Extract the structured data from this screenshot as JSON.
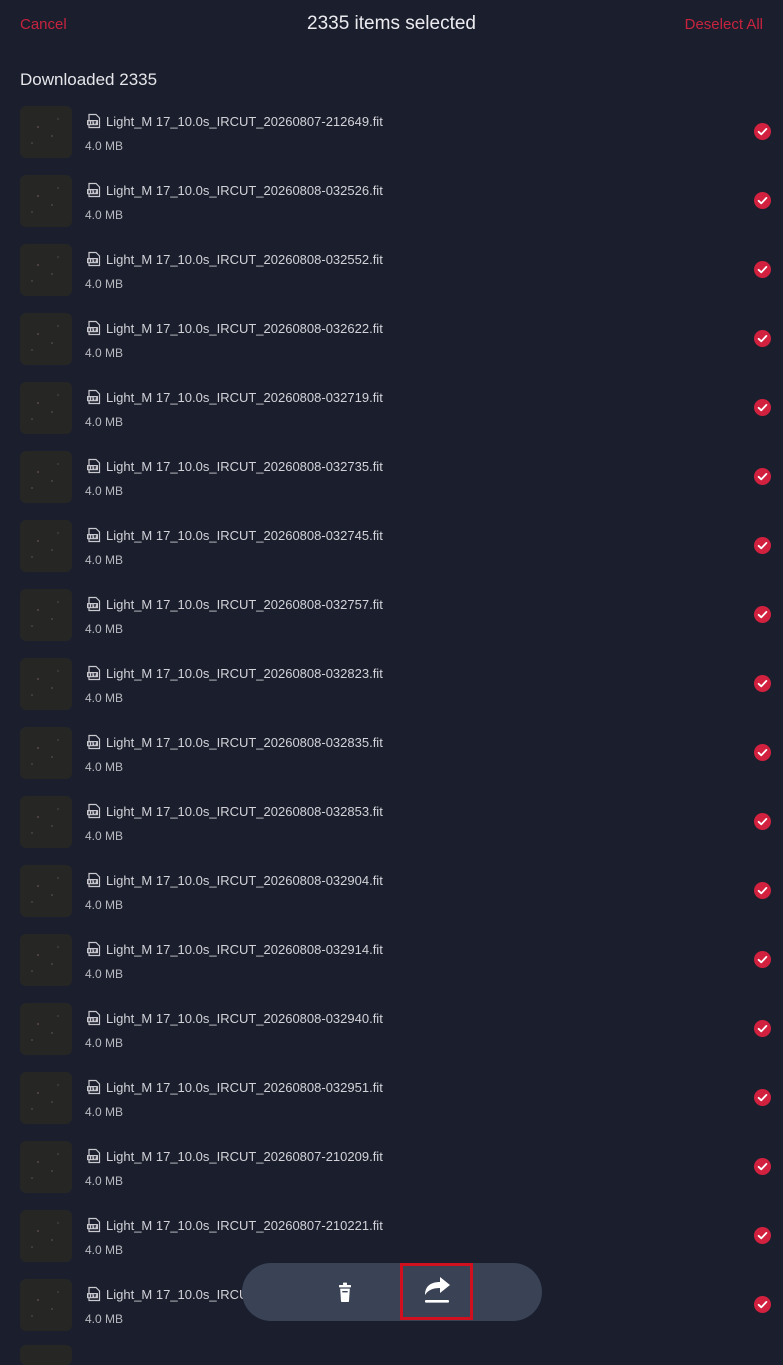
{
  "header": {
    "cancel_label": "Cancel",
    "title": "2335 items selected",
    "deselect_label": "Deselect All"
  },
  "section": {
    "title": "Downloaded 2335"
  },
  "files": [
    {
      "name": "Light_M 17_10.0s_IRCUT_20260807-212649.fit",
      "size": "4.0 MB",
      "selected": true
    },
    {
      "name": "Light_M 17_10.0s_IRCUT_20260808-032526.fit",
      "size": "4.0 MB",
      "selected": true
    },
    {
      "name": "Light_M 17_10.0s_IRCUT_20260808-032552.fit",
      "size": "4.0 MB",
      "selected": true
    },
    {
      "name": "Light_M 17_10.0s_IRCUT_20260808-032622.fit",
      "size": "4.0 MB",
      "selected": true
    },
    {
      "name": "Light_M 17_10.0s_IRCUT_20260808-032719.fit",
      "size": "4.0 MB",
      "selected": true
    },
    {
      "name": "Light_M 17_10.0s_IRCUT_20260808-032735.fit",
      "size": "4.0 MB",
      "selected": true
    },
    {
      "name": "Light_M 17_10.0s_IRCUT_20260808-032745.fit",
      "size": "4.0 MB",
      "selected": true
    },
    {
      "name": "Light_M 17_10.0s_IRCUT_20260808-032757.fit",
      "size": "4.0 MB",
      "selected": true
    },
    {
      "name": "Light_M 17_10.0s_IRCUT_20260808-032823.fit",
      "size": "4.0 MB",
      "selected": true
    },
    {
      "name": "Light_M 17_10.0s_IRCUT_20260808-032835.fit",
      "size": "4.0 MB",
      "selected": true
    },
    {
      "name": "Light_M 17_10.0s_IRCUT_20260808-032853.fit",
      "size": "4.0 MB",
      "selected": true
    },
    {
      "name": "Light_M 17_10.0s_IRCUT_20260808-032904.fit",
      "size": "4.0 MB",
      "selected": true
    },
    {
      "name": "Light_M 17_10.0s_IRCUT_20260808-032914.fit",
      "size": "4.0 MB",
      "selected": true
    },
    {
      "name": "Light_M 17_10.0s_IRCUT_20260808-032940.fit",
      "size": "4.0 MB",
      "selected": true
    },
    {
      "name": "Light_M 17_10.0s_IRCUT_20260808-032951.fit",
      "size": "4.0 MB",
      "selected": true
    },
    {
      "name": "Light_M 17_10.0s_IRCUT_20260807-210209.fit",
      "size": "4.0 MB",
      "selected": true
    },
    {
      "name": "Light_M 17_10.0s_IRCUT_20260807-210221.fit",
      "size": "4.0 MB",
      "selected": true
    },
    {
      "name": "Light_M 17_10.0s_IRCU",
      "size": "4.0 MB",
      "selected": true
    }
  ],
  "actions": {
    "delete_icon": "trash-icon",
    "share_icon": "share-icon"
  },
  "colors": {
    "background": "#1b1f2d",
    "accent": "#c7233f",
    "action_bar": "#3a4256",
    "highlight_box": "#d0101e"
  }
}
